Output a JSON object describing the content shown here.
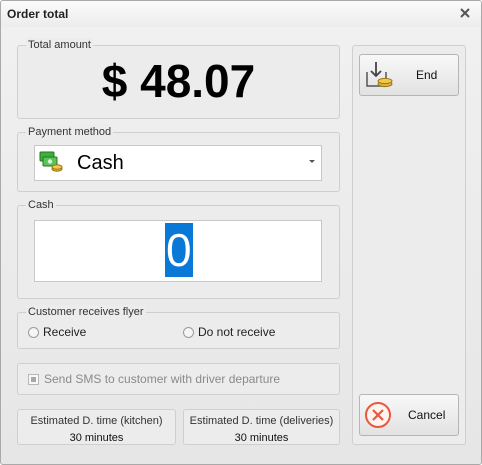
{
  "window": {
    "title": "Order total"
  },
  "total": {
    "label": "Total amount",
    "amount": "$ 48.07"
  },
  "payment": {
    "label": "Payment method",
    "selected": "Cash"
  },
  "cash": {
    "label": "Cash",
    "value": "0"
  },
  "flyer": {
    "label": "Customer receives flyer",
    "options": [
      "Receive",
      "Do not receive"
    ]
  },
  "sms": {
    "label": "Send SMS to customer with driver departure"
  },
  "estimates": {
    "kitchen": {
      "label": "Estimated D. time (kitchen)",
      "value": "30 minutes"
    },
    "deliveries": {
      "label": "Estimated D. time (deliveries)",
      "value": "30 minutes"
    }
  },
  "actions": {
    "end_label": "End",
    "cancel_label": "Cancel"
  },
  "colors": {
    "selection": "#0a78d7",
    "cancel_icon": "#e8583c"
  }
}
